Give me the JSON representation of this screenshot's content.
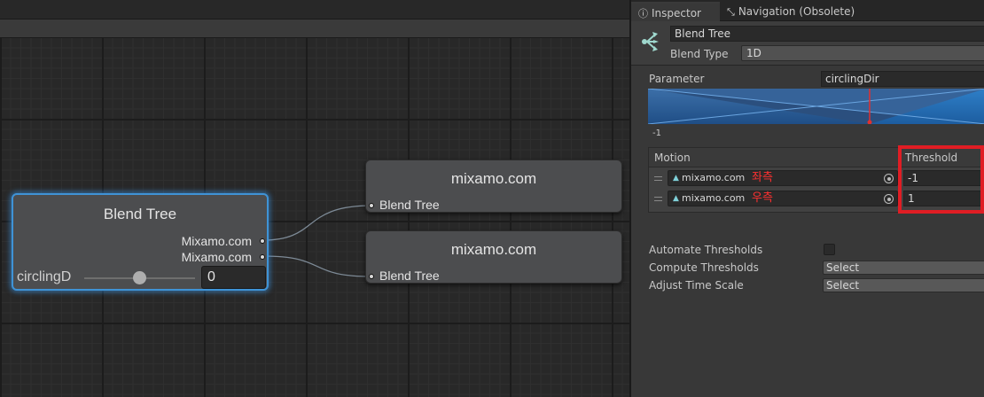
{
  "graph": {
    "blend_node": {
      "title": "Blend Tree",
      "outputs": [
        "Mixamo.com",
        "Mixamo.com"
      ],
      "parameter_label": "circlingD",
      "parameter_value": "0",
      "slider_fraction": 0.5
    },
    "child_nodes": [
      {
        "title": "mixamo.com",
        "port_label": "Blend Tree"
      },
      {
        "title": "mixamo.com",
        "port_label": "Blend Tree"
      }
    ]
  },
  "inspector": {
    "tabs": [
      {
        "label": "Inspector",
        "icon": "info-icon"
      },
      {
        "label": "Navigation (Obsolete)",
        "icon": "navigation-icon"
      }
    ],
    "name": "Blend Tree",
    "blend_type_label": "Blend Type",
    "blend_type_value": "1D",
    "parameter_label": "Parameter",
    "parameter_value": "circlingDir",
    "graph_min_label": "-1",
    "motion_header": "Motion",
    "threshold_header": "Threshold",
    "motions": [
      {
        "clip": "mixamo.com",
        "note": "좌측",
        "threshold": "-1"
      },
      {
        "clip": "mixamo.com",
        "note": "우측",
        "threshold": "1"
      }
    ],
    "automate_thresholds_label": "Automate Thresholds",
    "automate_thresholds_checked": false,
    "compute_thresholds_label": "Compute Thresholds",
    "compute_thresholds_value": "Select",
    "adjust_time_scale_label": "Adjust Time Scale",
    "adjust_time_scale_value": "Select",
    "colors": {
      "accent_blue": "#3f93d6",
      "highlight_red": "#e01d24",
      "note_red": "#ff3030"
    }
  }
}
